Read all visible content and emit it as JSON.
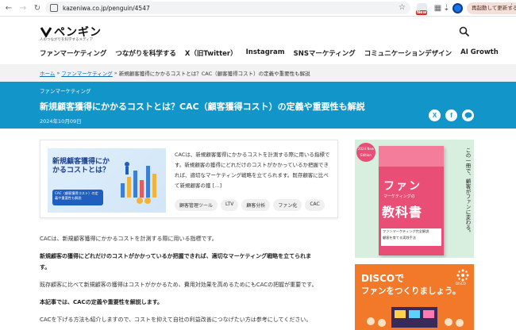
{
  "browser": {
    "url": "kazeniwa.co.jp/penguin/4547",
    "update_button": "再起動して更新する",
    "new_badge": "New"
  },
  "site": {
    "logo_text": "ペンギン",
    "tagline": "人のつながりを科学するメディア",
    "nav": [
      "ファンマーケティング",
      "つながりを科学する",
      "X（旧Twitter）",
      "Instagram",
      "SNSマーケティング",
      "コミュニケーションデザイン",
      "AI Growth"
    ]
  },
  "breadcrumb": {
    "home": "ホーム",
    "category": "ファンマーケティング",
    "current": "新規顧客獲得にかかるコストとは？CAC（顧客獲得コスト）の定義や重要性も解説",
    "separator": "»"
  },
  "article": {
    "category": "ファンマーケティング",
    "title": "新規顧客獲得にかかるコストとは？CAC（顧客獲得コスト）の定義や重要性も解説",
    "date": "2024年10月09日",
    "thumbnail": {
      "title": "新規顧客獲得にかかるコストとは？",
      "sub": "CAC（顧客獲得コスト）の定義や重要性も解説"
    },
    "excerpt": "CACは、新規顧客獲得にかかるコストを計測する際に用いる指標です。新規顧客の獲得にどれだけのコストがかかっているか把握できれば、適切なマーケティング戦略を立てられます。既存顧客に比べて新規顧客の獲 […]",
    "tags": [
      "顧客管理ツール",
      "LTV",
      "顧客分析",
      "ファン化",
      "CAC"
    ],
    "paragraphs": [
      "CACは、新規顧客獲得にかかるコストを計測する際に用いる指標です。",
      "新規顧客の獲得にどれだけのコストがかかっているか把握できれば、適切なマーケティング戦略を立てられま",
      "す。",
      "既存顧客に比べて新規顧客の獲得はコストがかかるため、費用対効果を高めるためにもCACの把握が重要です。",
      "本記事では、CACの定義や重要性を解説します。",
      "CACを下げる方法も紹介しますので、コストを抑えて自社の利益改善につなげたい方は参考にしてください。"
    ]
  },
  "ads": {
    "book": {
      "badge": "2024 New Edition",
      "top": "ファンマーケティング",
      "title": "ファン",
      "middle": "マーケティングの",
      "big": "教科書",
      "strip": [
        "ファンマーケティング完全解説",
        "顧客を育てる実践手法"
      ],
      "vertical": "この一冊で、顧客がファンに変わる。"
    },
    "disco": {
      "brand": "DISCOで",
      "catch": "ファンをつくりましょう。",
      "logo_text": "DISCO"
    }
  },
  "colors": {
    "accent": "#1296c9",
    "ad_book": "#e94e77",
    "ad_disco": "#f2792a"
  }
}
